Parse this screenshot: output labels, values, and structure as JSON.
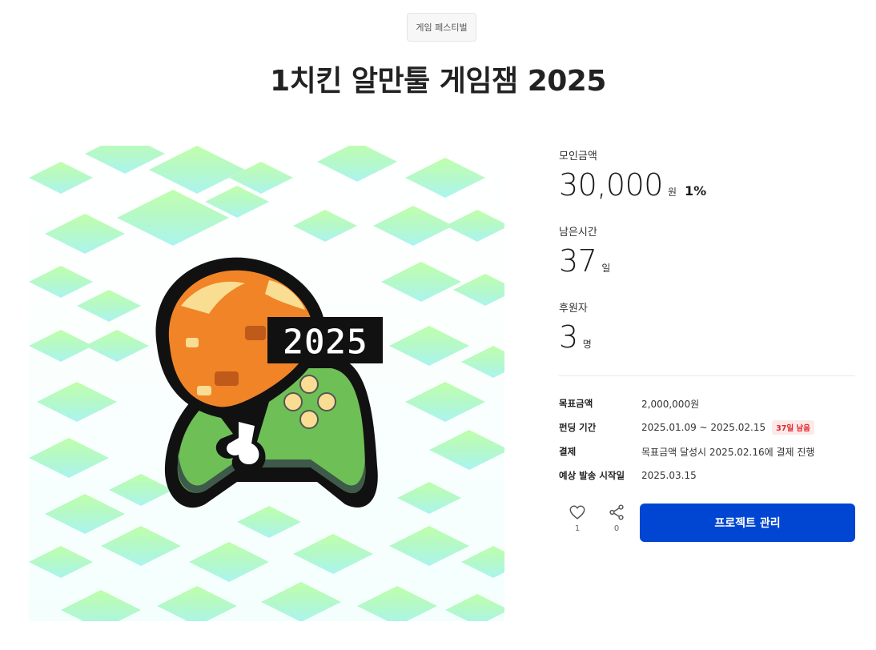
{
  "header": {
    "category": "게임 페스티벌",
    "title": "1치킨 알만툴 게임잼 2025"
  },
  "hero": {
    "badge_text": "2025",
    "colors": {
      "tile_green": "#b6ff9e",
      "tile_cyan": "#9ef3ee",
      "drumstick": "#f08427",
      "controller": "#6fbf57",
      "outline": "#111111"
    }
  },
  "stats": {
    "raised": {
      "label": "모인금액",
      "value": "30,000",
      "unit": "원",
      "percent": "1%"
    },
    "time_left": {
      "label": "남은시간",
      "value": "37",
      "unit": "일"
    },
    "backers": {
      "label": "후원자",
      "value": "3",
      "unit": "명"
    }
  },
  "details": {
    "goal": {
      "key": "목표금액",
      "value": "2,000,000원"
    },
    "period": {
      "key": "펀딩 기간",
      "value": "2025.01.09 ~ 2025.02.15",
      "badge": "37일 남음"
    },
    "payment": {
      "key": "결제",
      "value": "목표금액 달성시 2025.02.16에 결제 진행"
    },
    "shipping": {
      "key": "예상 발송 시작일",
      "value": "2025.03.15"
    }
  },
  "actions": {
    "like_count": "1",
    "share_count": "0",
    "manage_label": "프로젝트 관리",
    "colors": {
      "primary": "#0046d3",
      "badge_red": "#e0282e"
    }
  }
}
